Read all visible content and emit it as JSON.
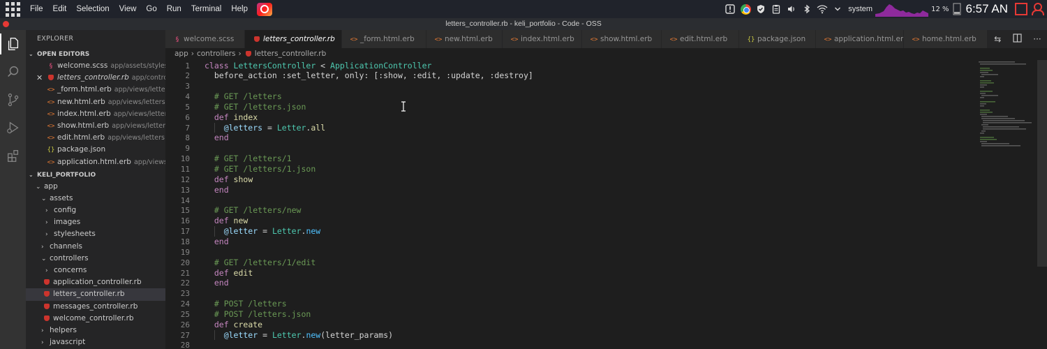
{
  "system_bar": {
    "menu": [
      "File",
      "Edit",
      "Selection",
      "View",
      "Go",
      "Run",
      "Terminal",
      "Help"
    ],
    "user": "system",
    "cpu_percent": "12 %",
    "clock": "6:57 AN"
  },
  "window": {
    "title": "letters_controller.rb - keli_portfolio - Code - OSS"
  },
  "explorer": {
    "title": "EXPLORER",
    "open_editors_title": "OPEN EDITORS",
    "open_editors": [
      {
        "name": "welcome.scss",
        "desc": "app/assets/styleshe...",
        "icon": "scss"
      },
      {
        "name": "letters_controller.rb",
        "desc": "app/controll...",
        "icon": "ruby"
      },
      {
        "name": "_form.html.erb",
        "desc": "app/views/letters",
        "icon": "html"
      },
      {
        "name": "new.html.erb",
        "desc": "app/views/letters",
        "icon": "html"
      },
      {
        "name": "index.html.erb",
        "desc": "app/views/letters",
        "icon": "html"
      },
      {
        "name": "show.html.erb",
        "desc": "app/views/letters",
        "icon": "html"
      },
      {
        "name": "edit.html.erb",
        "desc": "app/views/letters",
        "icon": "html"
      },
      {
        "name": "package.json",
        "desc": "",
        "icon": "json"
      },
      {
        "name": "application.html.erb",
        "desc": "app/views/l...",
        "icon": "html"
      }
    ],
    "project_title": "KELI_PORTFOLIO",
    "tree": [
      {
        "name": "app",
        "type": "folder-open",
        "depth": 1
      },
      {
        "name": "assets",
        "type": "folder-open",
        "depth": 2
      },
      {
        "name": "config",
        "type": "folder",
        "depth": 3
      },
      {
        "name": "images",
        "type": "folder",
        "depth": 3
      },
      {
        "name": "stylesheets",
        "type": "folder",
        "depth": 3
      },
      {
        "name": "channels",
        "type": "folder",
        "depth": 2
      },
      {
        "name": "controllers",
        "type": "folder-open",
        "depth": 2
      },
      {
        "name": "concerns",
        "type": "folder",
        "depth": 3
      },
      {
        "name": "application_controller.rb",
        "type": "ruby",
        "depth": 3
      },
      {
        "name": "letters_controller.rb",
        "type": "ruby",
        "depth": 3
      },
      {
        "name": "messages_controller.rb",
        "type": "ruby",
        "depth": 3
      },
      {
        "name": "welcome_controller.rb",
        "type": "ruby",
        "depth": 3
      },
      {
        "name": "helpers",
        "type": "folder",
        "depth": 2
      },
      {
        "name": "javascript",
        "type": "folder",
        "depth": 2
      }
    ]
  },
  "tabs": [
    {
      "label": "welcome.scss",
      "icon": "scss"
    },
    {
      "label": "letters_controller.rb",
      "icon": "ruby"
    },
    {
      "label": "_form.html.erb",
      "icon": "html"
    },
    {
      "label": "new.html.erb",
      "icon": "html"
    },
    {
      "label": "index.html.erb",
      "icon": "html"
    },
    {
      "label": "show.html.erb",
      "icon": "html"
    },
    {
      "label": "edit.html.erb",
      "icon": "html"
    },
    {
      "label": "package.json",
      "icon": "json"
    },
    {
      "label": "application.html.erb",
      "icon": "html"
    },
    {
      "label": "home.html.erb",
      "icon": "html"
    }
  ],
  "breadcrumb": [
    "app",
    "controllers",
    "letters_controller.rb"
  ],
  "code_lines": [
    [
      [
        "kw",
        "class "
      ],
      [
        "cls",
        "LettersController"
      ],
      [
        "sym",
        " < "
      ],
      [
        "cls",
        "ApplicationController"
      ]
    ],
    [
      [
        "sym",
        "  before_action :set_letter, only: [:show, :edit, :update, :destroy]"
      ]
    ],
    [],
    [
      [
        "cm",
        "  # GET /letters"
      ]
    ],
    [
      [
        "cm",
        "  # GET /letters.json"
      ]
    ],
    [
      [
        "kw",
        "  def "
      ],
      [
        "fn",
        "index"
      ]
    ],
    [
      [
        "ivar",
        "    @letters"
      ],
      [
        "sym",
        " = "
      ],
      [
        "cls",
        "Letter"
      ],
      [
        "sym",
        "."
      ],
      [
        "fn",
        "all"
      ]
    ],
    [
      [
        "kw",
        "  end"
      ]
    ],
    [],
    [
      [
        "cm",
        "  # GET /letters/1"
      ]
    ],
    [
      [
        "cm",
        "  # GET /letters/1.json"
      ]
    ],
    [
      [
        "kw",
        "  def "
      ],
      [
        "fn",
        "show"
      ]
    ],
    [
      [
        "kw",
        "  end"
      ]
    ],
    [],
    [
      [
        "cm",
        "  # GET /letters/new"
      ]
    ],
    [
      [
        "kw",
        "  def "
      ],
      [
        "fn",
        "new"
      ]
    ],
    [
      [
        "ivar",
        "    @letter"
      ],
      [
        "sym",
        " = "
      ],
      [
        "cls",
        "Letter"
      ],
      [
        "sym",
        "."
      ],
      [
        "mth",
        "new"
      ]
    ],
    [
      [
        "kw",
        "  end"
      ]
    ],
    [],
    [
      [
        "cm",
        "  # GET /letters/1/edit"
      ]
    ],
    [
      [
        "kw",
        "  def "
      ],
      [
        "fn",
        "edit"
      ]
    ],
    [
      [
        "kw",
        "  end"
      ]
    ],
    [],
    [
      [
        "cm",
        "  # POST /letters"
      ]
    ],
    [
      [
        "cm",
        "  # POST /letters.json"
      ]
    ],
    [
      [
        "kw",
        "  def "
      ],
      [
        "fn",
        "create"
      ]
    ],
    [
      [
        "ivar",
        "    @letter"
      ],
      [
        "sym",
        " = "
      ],
      [
        "cls",
        "Letter"
      ],
      [
        "sym",
        "."
      ],
      [
        "mth",
        "new"
      ],
      [
        "sym",
        "(letter_params)"
      ]
    ],
    []
  ],
  "colors": {
    "editor_bg": "#1e1e1e",
    "sidebar_bg": "#252526",
    "activity_bg": "#333333",
    "keyword": "#c586c0",
    "class": "#4ec9b0",
    "comment": "#6a9955",
    "function": "#dcdcaa"
  }
}
